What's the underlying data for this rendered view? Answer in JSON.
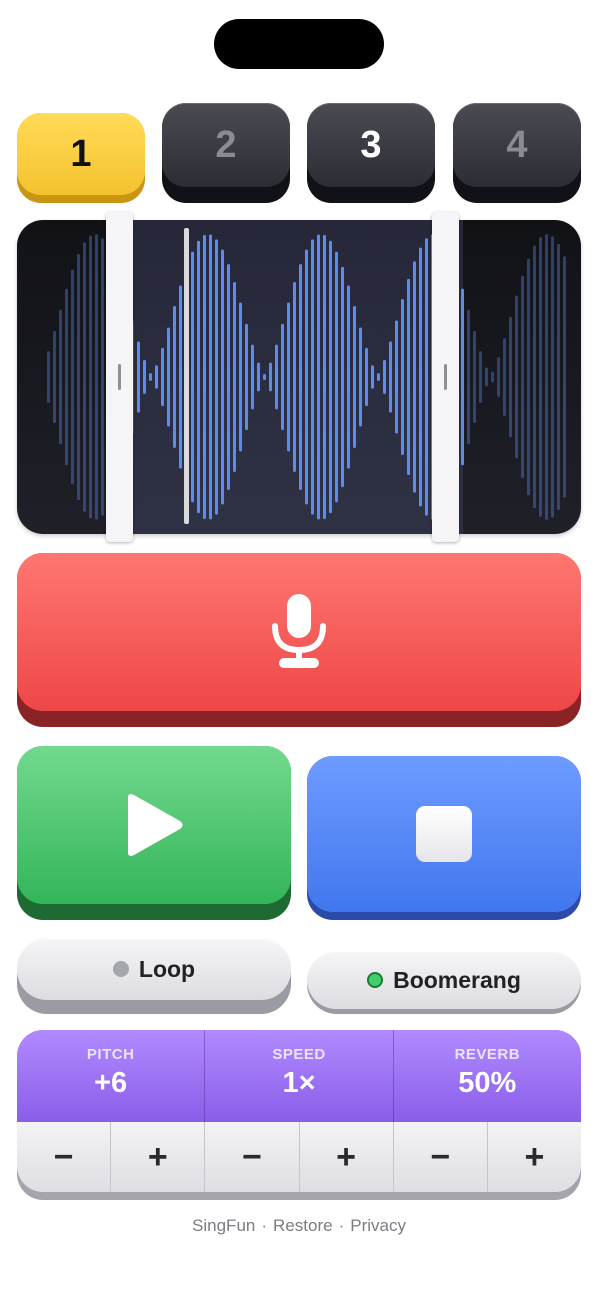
{
  "slots": [
    {
      "label": "1",
      "state": "active"
    },
    {
      "label": "2",
      "state": "empty"
    },
    {
      "label": "3",
      "state": "recorded"
    },
    {
      "label": "4",
      "state": "empty"
    }
  ],
  "icons": {
    "record": "microphone-icon",
    "play": "play-icon",
    "stop": "stop-icon"
  },
  "toggles": {
    "loop": {
      "label": "Loop",
      "on": false
    },
    "boomerang": {
      "label": "Boomerang",
      "on": true
    }
  },
  "effects": [
    {
      "label": "PITCH",
      "value": "+6",
      "decrease": "−",
      "increase": "+"
    },
    {
      "label": "SPEED",
      "value": "1×",
      "decrease": "−",
      "increase": "+"
    },
    {
      "label": "REVERB",
      "value": "50%",
      "decrease": "−",
      "increase": "+"
    }
  ],
  "footer": {
    "app_name": "SingFun",
    "restore": "Restore",
    "privacy": "Privacy",
    "separator": "·"
  },
  "colors": {
    "record": "#ee4747",
    "play": "#34b559",
    "stop": "#4177ee",
    "slot_active": "#f4c22f",
    "waveform": "#5b8cf0",
    "effects": "#8a5ee8"
  }
}
